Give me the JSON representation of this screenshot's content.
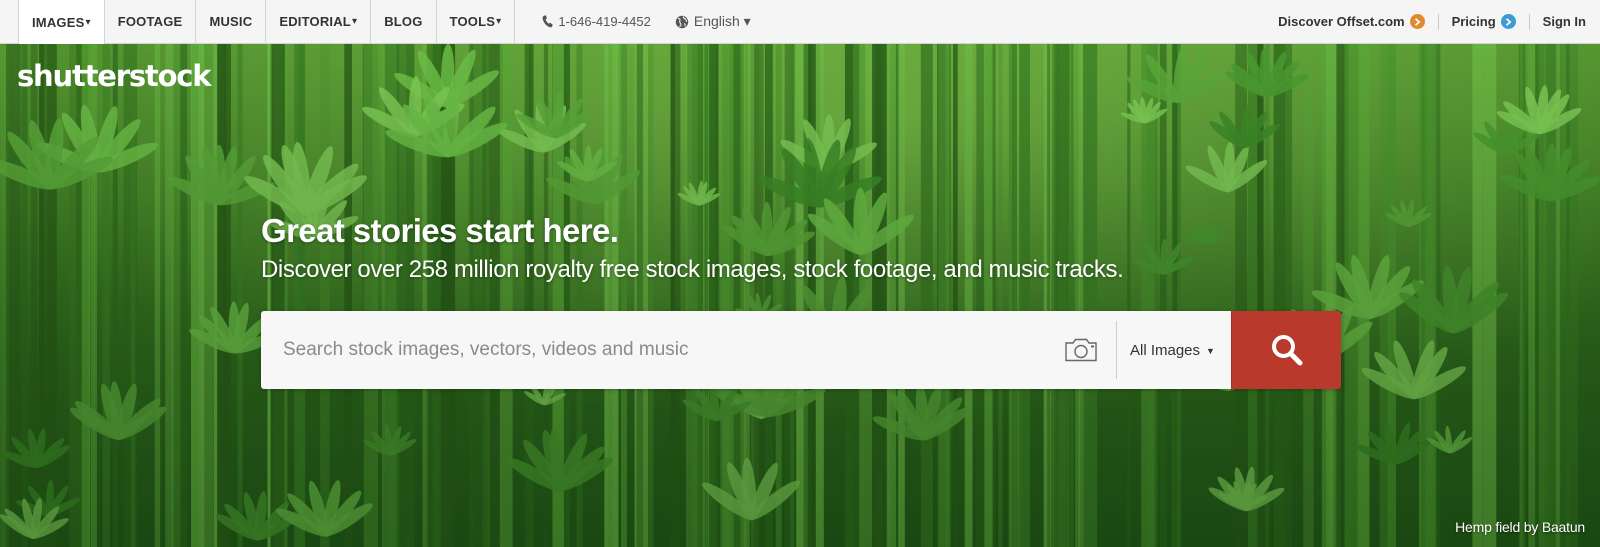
{
  "nav": {
    "items": [
      {
        "label": "IMAGES",
        "caret": "▾"
      },
      {
        "label": "FOOTAGE",
        "caret": ""
      },
      {
        "label": "MUSIC",
        "caret": ""
      },
      {
        "label": "EDITORIAL",
        "caret": "▾"
      },
      {
        "label": "BLOG",
        "caret": ""
      },
      {
        "label": "TOOLS",
        "caret": "▾"
      }
    ],
    "phone": "1-646-419-4452",
    "language": "English ▾",
    "discover": "Discover Offset.com",
    "pricing": "Pricing",
    "signin": "Sign In"
  },
  "hero": {
    "logo": "shutterstock",
    "headline": "Great stories start here.",
    "subheadline": "Discover over 258 million royalty free stock images, stock footage, and music tracks.",
    "credit": "Hemp field by Baatun"
  },
  "search": {
    "placeholder": "Search stock images, vectors, videos and music",
    "type": "All Images"
  },
  "colors": {
    "search_button": "#b9392c",
    "discover_arrow": "#e08a2e",
    "pricing_arrow": "#3a9bd5"
  }
}
